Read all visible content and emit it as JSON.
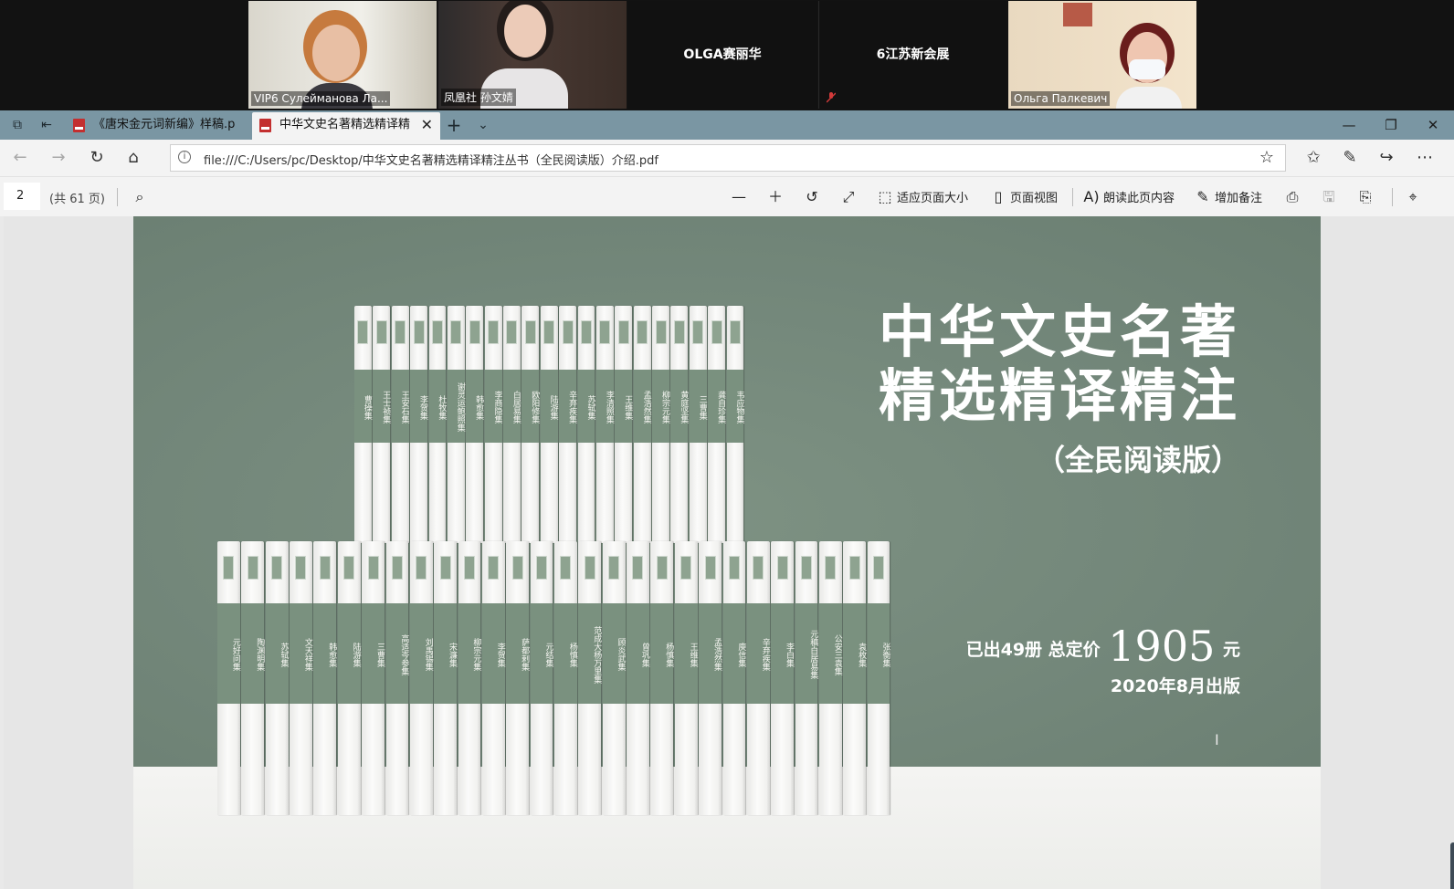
{
  "conference": {
    "participants": [
      {
        "name": "VIP6 Сулейманова Ла...",
        "type": "video"
      },
      {
        "name": "凤凰社 孙文婧",
        "type": "video"
      },
      {
        "name": "OLGA赛丽华",
        "type": "audio"
      },
      {
        "name": "6江苏新会展",
        "type": "audio",
        "muted": true
      },
      {
        "name": "Ольга Палкевич",
        "type": "video"
      }
    ]
  },
  "browser": {
    "tabs": [
      {
        "label": "《唐宋金元词新编》样稿.p",
        "active": false
      },
      {
        "label": "中华文史名著精选精译精",
        "active": true
      }
    ],
    "new_tab_label": "+",
    "address": "file:///C:/Users/pc/Desktop/中华文史名著精选精译精注丛书（全民阅读版）介绍.pdf"
  },
  "pdf_toolbar": {
    "page_number": "2",
    "page_total": "(共 61 页)",
    "fit_page": "适应页面大小",
    "page_view": "页面视图",
    "read_aloud": "朗读此页内容",
    "add_notes": "增加备注"
  },
  "document": {
    "title_line1": "中华文史名著",
    "title_line2": "精选精译精注",
    "subtitle": "（全民阅读版）",
    "price_prefix": "已出49册 总定价",
    "price_value": "1905",
    "price_unit": "元",
    "publish_date": "2020年8月出版",
    "cursor_glyph": "I",
    "top_row_books": [
      "曹操集",
      "王士祯集",
      "王安石集",
      "李贺集",
      "杜牧集",
      "谢灵运鲍照集",
      "韩愈集",
      "李商隐集",
      "白居易集",
      "欧阳修集",
      "陆游集",
      "辛弃疾集",
      "苏轼集",
      "李清照集",
      "王维集",
      "孟浩然集",
      "柳宗元集",
      "黄庭坚集",
      "三曹集",
      "龚自珍集",
      "韦应物集"
    ],
    "bottom_row_books": [
      "元好问集",
      "陶渊明集",
      "苏轼集",
      "文天祥集",
      "韩愈集",
      "陆游集",
      "三曹集",
      "高适岑参集",
      "刘禹锡集",
      "宋濂集",
      "柳宗元集",
      "李贺集",
      "萨都剌集",
      "元结集",
      "杨慎集",
      "范成大杨万里集",
      "顾炎武集",
      "曾巩集",
      "杨慎集",
      "王维集",
      "孟浩然集",
      "庾信集",
      "辛弃疾集",
      "李白集",
      "元稹白居易集",
      "公安三袁集",
      "袁枚集",
      "张衡集"
    ]
  }
}
